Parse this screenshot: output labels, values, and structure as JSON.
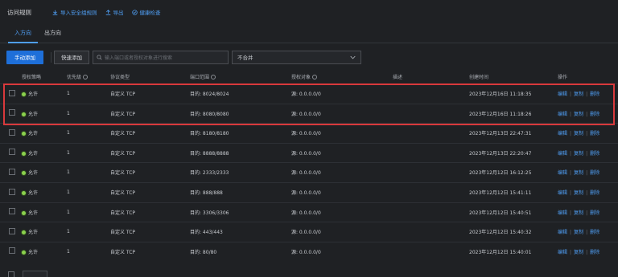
{
  "header": {
    "title": "访问规则",
    "import_label": "导入安全组规则",
    "export_label": "导出",
    "health_label": "健康检查"
  },
  "tabs": [
    {
      "label": "入方向",
      "active": true
    },
    {
      "label": "出方向",
      "active": false
    }
  ],
  "toolbar": {
    "manual_add": "手动添加",
    "quick_add": "快速添加",
    "search_placeholder": "输入端口或者授权对象进行搜索",
    "merge_select": "不合并"
  },
  "columns": {
    "policy": "授权策略",
    "priority": "优先级",
    "protocol": "协议类型",
    "port": "端口范围",
    "source": "授权对象",
    "description": "描述",
    "created": "创建时间",
    "operations": "操作"
  },
  "rows": [
    {
      "policy": "允许",
      "priority": "1",
      "protocol": "自定义 TCP",
      "port": "目的: 8024/8024",
      "source": "源: 0.0.0.0/0",
      "created": "2023年12月16日 11:18:35"
    },
    {
      "policy": "允许",
      "priority": "1",
      "protocol": "自定义 TCP",
      "port": "目的: 8080/8080",
      "source": "源: 0.0.0.0/0",
      "created": "2023年12月16日 11:18:26"
    },
    {
      "policy": "允许",
      "priority": "1",
      "protocol": "自定义 TCP",
      "port": "目的: 8180/8180",
      "source": "源: 0.0.0.0/0",
      "created": "2023年12月13日 22:47:31"
    },
    {
      "policy": "允许",
      "priority": "1",
      "protocol": "自定义 TCP",
      "port": "目的: 8888/8888",
      "source": "源: 0.0.0.0/0",
      "created": "2023年12月13日 22:20:47"
    },
    {
      "policy": "允许",
      "priority": "1",
      "protocol": "自定义 TCP",
      "port": "目的: 2333/2333",
      "source": "源: 0.0.0.0/0",
      "created": "2023年12月12日 16:12:25"
    },
    {
      "policy": "允许",
      "priority": "1",
      "protocol": "自定义 TCP",
      "port": "目的: 888/888",
      "source": "源: 0.0.0.0/0",
      "created": "2023年12月12日 15:41:11"
    },
    {
      "policy": "允许",
      "priority": "1",
      "protocol": "自定义 TCP",
      "port": "目的: 3306/3306",
      "source": "源: 0.0.0.0/0",
      "created": "2023年12月12日 15:40:51"
    },
    {
      "policy": "允许",
      "priority": "1",
      "protocol": "自定义 TCP",
      "port": "目的: 443/443",
      "source": "源: 0.0.0.0/0",
      "created": "2023年12月12日 15:40:32"
    },
    {
      "policy": "允许",
      "priority": "1",
      "protocol": "自定义 TCP",
      "port": "目的: 80/80",
      "source": "源: 0.0.0.0/0",
      "created": "2023年12月12日 15:40:01"
    }
  ],
  "operations": {
    "edit": "编辑",
    "copy": "复制",
    "delete": "删除",
    "separator": "|"
  },
  "colors": {
    "accent": "#4f9ff5",
    "primary_button": "#1e6fd9",
    "highlight": "#d9393c",
    "allow_dot": "#8bd14e",
    "background": "#1f2124"
  },
  "icons": [
    "import-icon",
    "export-icon",
    "health-check-icon",
    "search-icon",
    "chevron-down-icon",
    "info-icon",
    "status-dot-icon"
  ]
}
